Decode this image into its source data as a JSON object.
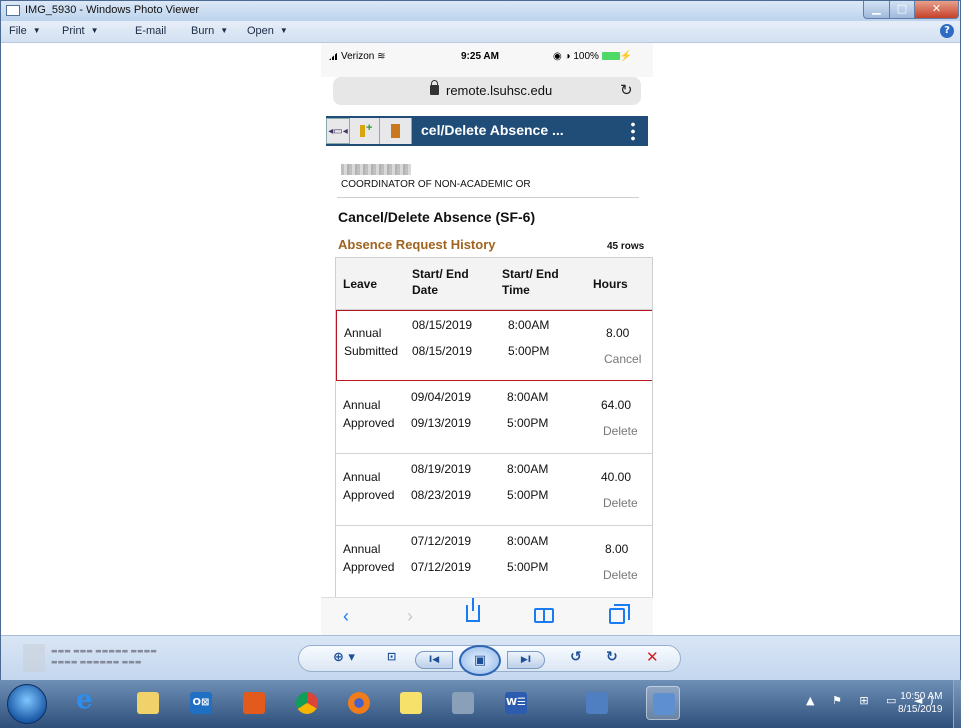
{
  "window": {
    "title": "IMG_5930 - Windows Photo Viewer",
    "controls": {
      "minimize": "▁",
      "maximize": "□",
      "close": "✕"
    }
  },
  "menu": [
    {
      "label": "File",
      "caret": "▼"
    },
    {
      "label": "Print",
      "caret": "▼"
    },
    {
      "label": "E-mail"
    },
    {
      "label": "Burn",
      "caret": "▼"
    },
    {
      "label": "Open",
      "caret": "▼"
    }
  ],
  "help": "?",
  "phone": {
    "status": {
      "carrier": "Verizon",
      "time": "9:25 AM",
      "battery": "◉ ◑ 100%",
      "charge": "⚡"
    },
    "url": "remote.lsuhsc.edu",
    "reload_glyph": "↻",
    "header": {
      "nav_glyph": "◂▭◂",
      "title": "cel/Delete Absence ..."
    },
    "position_title": "COORDINATOR OF NON-ACADEMIC OR",
    "form_title": "Cancel/Delete Absence (SF-6)",
    "grid_title": "Absence Request History",
    "row_count": "45 rows",
    "columns": {
      "leave": "Leave",
      "start_end_date": [
        "Start/ End",
        "Date"
      ],
      "start_end_time": [
        "Start/ End",
        "Time"
      ],
      "hours": "Hours"
    },
    "rows": [
      {
        "type": "Annual",
        "status": "Submitted",
        "start_date": "08/15/2019",
        "end_date": "08/15/2019",
        "start_time": "8:00AM",
        "end_time": "5:00PM",
        "hours": "8.00",
        "action": "Cancel",
        "selected": true
      },
      {
        "type": "Annual",
        "status": "Approved",
        "start_date": "09/04/2019",
        "end_date": "09/13/2019",
        "start_time": "8:00AM",
        "end_time": "5:00PM",
        "hours": "64.00",
        "action": "Delete"
      },
      {
        "type": "Annual",
        "status": "Approved",
        "start_date": "08/19/2019",
        "end_date": "08/23/2019",
        "start_time": "8:00AM",
        "end_time": "5:00PM",
        "hours": "40.00",
        "action": "Delete"
      },
      {
        "type": "Annual",
        "status": "Approved",
        "start_date": "07/12/2019",
        "end_date": "07/12/2019",
        "start_time": "8:00AM",
        "end_time": "5:00PM",
        "hours": "8.00",
        "action": "Delete"
      }
    ],
    "safari": {
      "back": "‹",
      "forward": "›"
    }
  },
  "viewer_controls": {
    "zoom": "⊕ ▾",
    "fit": "⊡",
    "prev": "I◀",
    "slideshow": "▣",
    "next": "▶I",
    "rotate_left": "↺",
    "rotate_right": "↻",
    "delete": "✕"
  },
  "taskbar": {
    "apps": [
      "start",
      "internet-explorer",
      "file-explorer",
      "outlook",
      "office",
      "chrome",
      "firefox",
      "sticky-notes",
      "book-app",
      "word",
      "remote-desktop",
      "photo-viewer"
    ],
    "app_labels": {
      "outlook": "O⊠",
      "word": "W☰",
      "ie": "e"
    },
    "tray_glyphs": "▲ ⚑ ⊞ ▭ ◄)",
    "time": "10:50 AM",
    "date": "8/15/2019"
  },
  "colors": {
    "accent_blue": "#1f4d78",
    "grid_title": "#a0641e",
    "selection": "#b5161f",
    "ios_blue": "#1a7cf2"
  }
}
